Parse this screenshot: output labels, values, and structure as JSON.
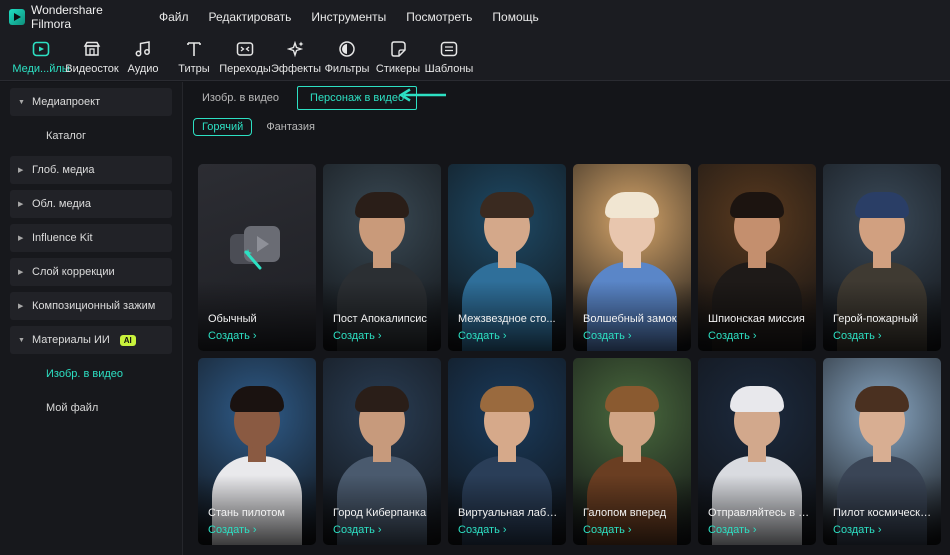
{
  "app": {
    "title": "Wondershare Filmora"
  },
  "menu": [
    "Файл",
    "Редактировать",
    "Инструменты",
    "Посмотреть",
    "Помощь"
  ],
  "toolbar": [
    {
      "label": "Меди...йлы",
      "icon": "media-icon",
      "active": true
    },
    {
      "label": "Видеосток",
      "icon": "stock-icon"
    },
    {
      "label": "Аудио",
      "icon": "music-note-icon"
    },
    {
      "label": "Титры",
      "icon": "text-icon"
    },
    {
      "label": "Переходы",
      "icon": "transition-icon"
    },
    {
      "label": "Эффекты",
      "icon": "sparkle-icon"
    },
    {
      "label": "Фильтры",
      "icon": "filter-icon"
    },
    {
      "label": "Стикеры",
      "icon": "sticker-icon"
    },
    {
      "label": "Шаблоны",
      "icon": "template-icon"
    }
  ],
  "sidebar": {
    "items": [
      {
        "label": "Медиапроект",
        "type": "head",
        "expanded": true
      },
      {
        "label": "Каталог",
        "type": "sub"
      },
      {
        "label": "Глоб. медиа",
        "type": "head"
      },
      {
        "label": "Обл. медиа",
        "type": "head"
      },
      {
        "label": "Influence Kit",
        "type": "head"
      },
      {
        "label": "Слой коррекции",
        "type": "head"
      },
      {
        "label": "Композиционный зажим",
        "type": "head"
      },
      {
        "label": "Материалы ИИ",
        "type": "head",
        "expanded": true,
        "badge": "AI"
      },
      {
        "label": "Изобр. в видео",
        "type": "sub",
        "active": true
      },
      {
        "label": "Мой файл",
        "type": "sub"
      }
    ]
  },
  "tabs": [
    {
      "label": "Изобр. в видео"
    },
    {
      "label": "Персонаж в видео",
      "active": true
    }
  ],
  "chips": [
    {
      "label": "Горячий",
      "active": true
    },
    {
      "label": "Фантазия"
    }
  ],
  "create_label": "Создать ›",
  "cards": [
    {
      "title": "Обычный",
      "bg": "#26272d",
      "skin": "",
      "placeholder": true
    },
    {
      "title": "Пост Апокалипсис",
      "bg": "#3a4a55",
      "skin": "#c99a7a",
      "hair": "#2a1e18",
      "cloth": "#2b2f33"
    },
    {
      "title": "Межзвездное сто...",
      "bg": "#1e4a66",
      "skin": "#d4a88a",
      "hair": "#3a2a20",
      "cloth": "#2f6f9a"
    },
    {
      "title": "Волшебный замок",
      "bg": "#d7a66a",
      "skin": "#e8c6ae",
      "hair": "#f1e6d2",
      "cloth": "#5a86c8"
    },
    {
      "title": "Шпионская миссия",
      "bg": "#5a3a1e",
      "skin": "#c48f6e",
      "hair": "#1c1410",
      "cloth": "#1e1a18"
    },
    {
      "title": "Герой-пожарный",
      "bg": "#3b4b5a",
      "skin": "#d1a080",
      "hair": "#2a3e66",
      "cloth": "#3f3a32"
    },
    {
      "title": "Стань пилотом",
      "bg": "#2f5c8a",
      "skin": "#8a5a42",
      "hair": "#1a1210",
      "cloth": "#e9e9ec"
    },
    {
      "title": "Город Киберпанка",
      "bg": "#2a3e55",
      "skin": "#c79a7c",
      "hair": "#2a1e18",
      "cloth": "#4a5a6e"
    },
    {
      "title": "Виртуальная лабо...",
      "bg": "#1a3b5c",
      "skin": "#d6a98a",
      "hair": "#9a6a3e",
      "cloth": "#2a3e58"
    },
    {
      "title": "Галопом вперед",
      "bg": "#4a6a3e",
      "skin": "#d0a484",
      "hair": "#8a5a30",
      "cloth": "#6a3e22"
    },
    {
      "title": "Отправляйтесь в к...",
      "bg": "#1c2a3e",
      "skin": "#d2a88c",
      "hair": "#e8e8ec",
      "cloth": "#d9dbe0"
    },
    {
      "title": "Пилот космическо...",
      "bg": "#8aa8c4",
      "skin": "#d8ae92",
      "hair": "#4a3020",
      "cloth": "#3a4556"
    }
  ]
}
